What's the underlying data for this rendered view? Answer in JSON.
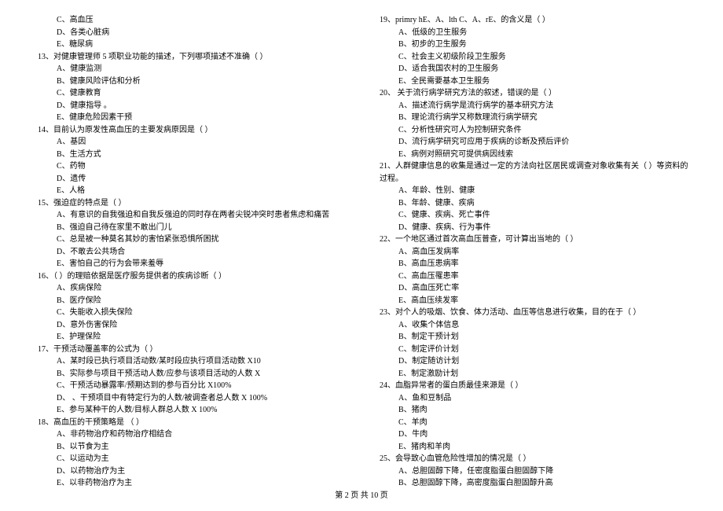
{
  "left": [
    {
      "cls": "opt",
      "t": "C、高血压"
    },
    {
      "cls": "opt",
      "t": "D、各类心脏病"
    },
    {
      "cls": "opt",
      "t": "E、糖尿病"
    },
    {
      "cls": "qnum",
      "t": "13、对健康管理师 5 项职业功能的描述，下列哪项描述不准确（    ）"
    },
    {
      "cls": "opt",
      "t": "A、健康监测"
    },
    {
      "cls": "opt",
      "t": "B、健康风险评估和分析"
    },
    {
      "cls": "opt",
      "t": "C、健康教育"
    },
    {
      "cls": "opt",
      "t": "D、健康指导 。"
    },
    {
      "cls": "opt",
      "t": "E、健康危险因素干预"
    },
    {
      "cls": "qnum",
      "t": "14、目前认为原发性高血压的主要发病原因是（    ）"
    },
    {
      "cls": "opt",
      "t": "A、基因"
    },
    {
      "cls": "opt",
      "t": "B、生活方式"
    },
    {
      "cls": "opt",
      "t": "C、药物"
    },
    {
      "cls": "opt",
      "t": "D、遗传"
    },
    {
      "cls": "opt",
      "t": "E、人格"
    },
    {
      "cls": "qnum",
      "t": "15、强迫症的特点是（    ）"
    },
    {
      "cls": "opt",
      "t": "A、有意识的自我强迫和自我反强迫的同时存在两者尖锐冲突时患者焦虑和痛苦"
    },
    {
      "cls": "opt",
      "t": "B、强迫自己待在家里不敢出门儿"
    },
    {
      "cls": "opt",
      "t": "C、总是被一种莫名其妙的害怕紧张恐惧所困扰"
    },
    {
      "cls": "opt",
      "t": "D、不敢去公共场合"
    },
    {
      "cls": "opt",
      "t": "E、害怕自己的行为会带来羞辱"
    },
    {
      "cls": "qnum",
      "t": "16、（    ）的理赔依据是医疗服务提供者的疾病诊断（    ）"
    },
    {
      "cls": "opt",
      "t": "A、疾病保险"
    },
    {
      "cls": "opt",
      "t": "B、医疗保险"
    },
    {
      "cls": "opt",
      "t": "C、失能收入损失保险"
    },
    {
      "cls": "opt",
      "t": "D、意外伤害保险"
    },
    {
      "cls": "opt",
      "t": "E、护理保险"
    },
    {
      "cls": "qnum",
      "t": "17、干预活动覆盖率的公式为（    ）"
    },
    {
      "cls": "opt",
      "t": "A、某时段已执行项目活动数/某时段应执行项目活动数 X10"
    },
    {
      "cls": "opt",
      "t": "B、实际参与项目干预活动人数/应参与该项目活动的人数 X"
    },
    {
      "cls": "opt",
      "t": "C、干预活动暴露率/预期达到的参与百分比 X100%"
    },
    {
      "cls": "opt",
      "t": "D、 、干预项目中有特定行为的人数/被调查者总人数 X 100%"
    },
    {
      "cls": "opt",
      "t": "E、参与某种干的人数/目标人群总人数 X 100%"
    },
    {
      "cls": "qnum",
      "t": "18、高血压的干预策略是 （    ）"
    },
    {
      "cls": "opt",
      "t": "A、非药物治疗和药物治疗相结合"
    },
    {
      "cls": "opt",
      "t": "B、以节食为主"
    },
    {
      "cls": "opt",
      "t": "C、以运动为主"
    },
    {
      "cls": "opt",
      "t": "D、以药物治疗为主"
    },
    {
      "cls": "opt",
      "t": "E、以非药物治疗为主"
    }
  ],
  "right": [
    {
      "cls": "qnum",
      "t": "19、primry hE、A、lth C、A、rE、的含义是（    ）"
    },
    {
      "cls": "opt",
      "t": "A、低级的卫生服务"
    },
    {
      "cls": "opt",
      "t": "B、初步的卫生服务"
    },
    {
      "cls": "opt",
      "t": "C、社会主义初级阶段卫生服务"
    },
    {
      "cls": "opt",
      "t": "D、适合我国农村的卫生服务"
    },
    {
      "cls": "opt",
      "t": "E、全民需要基本卫生服务"
    },
    {
      "cls": "qnum",
      "t": "20、 关于流行病学研究方法的叙述，错误的是（    ）"
    },
    {
      "cls": "opt",
      "t": "A、描述流行病学是流行病学的基本研究方法"
    },
    {
      "cls": "opt",
      "t": "B、理论流行病学又称数理流行病学研究"
    },
    {
      "cls": "opt",
      "t": "C、分析性研究可人为控制研究条件"
    },
    {
      "cls": "opt",
      "t": "D、流行病学研究可应用于疾病的诊断及预后评价"
    },
    {
      "cls": "opt",
      "t": "E、病例对照研究可提供病因线索"
    },
    {
      "cls": "qnum",
      "t": "21、人群健康信息的收集是通过一定的方法向社区居民或调查对象收集有关（    ）等资料的"
    },
    {
      "cls": "qnum",
      "t": "过程。"
    },
    {
      "cls": "opt",
      "t": "A、年龄、性别、健康"
    },
    {
      "cls": "opt",
      "t": "B、年龄、健康、疾病"
    },
    {
      "cls": "opt",
      "t": "C、健康、疾病、死亡事件"
    },
    {
      "cls": "opt",
      "t": "D、健康、疾病、行为事件"
    },
    {
      "cls": "qnum",
      "t": "22、一个地区通过首次高血压普查，可计算出当地的（    ）"
    },
    {
      "cls": "opt",
      "t": "A、高血压发病率"
    },
    {
      "cls": "opt",
      "t": "B、高血压患病率"
    },
    {
      "cls": "opt",
      "t": "C、高血压罹患率"
    },
    {
      "cls": "opt",
      "t": "D、高血压死亡率"
    },
    {
      "cls": "opt",
      "t": "E、高血压续发率"
    },
    {
      "cls": "qnum",
      "t": "23、对个人的吸烟、饮食、体力活动、血压等信息进行收集，目的在于（    ）"
    },
    {
      "cls": "opt",
      "t": "A、收集个体信息"
    },
    {
      "cls": "opt",
      "t": "B、制定干预计划"
    },
    {
      "cls": "opt",
      "t": "C、制定评价计划"
    },
    {
      "cls": "opt",
      "t": "D、制定随访计划"
    },
    {
      "cls": "opt",
      "t": "E、制定激励计划"
    },
    {
      "cls": "qnum",
      "t": "24、血脂异常者的蛋白质最佳来源是（    ）"
    },
    {
      "cls": "opt",
      "t": "A、鱼和豆制品"
    },
    {
      "cls": "opt",
      "t": "B、猪肉"
    },
    {
      "cls": "opt",
      "t": "C、羊肉"
    },
    {
      "cls": "opt",
      "t": "D、牛肉"
    },
    {
      "cls": "opt",
      "t": "E、猪肉和羊肉"
    },
    {
      "cls": "qnum",
      "t": "25、会导致心血管危险性增加的情况是（    ）"
    },
    {
      "cls": "opt",
      "t": "A、总胆固醇下降，任密度脂蛋白胆固醇下降"
    },
    {
      "cls": "opt",
      "t": "B、总胆固醇下降，高密度脂蛋白胆固醇升高"
    }
  ],
  "footer": "第 2 页 共 10 页"
}
